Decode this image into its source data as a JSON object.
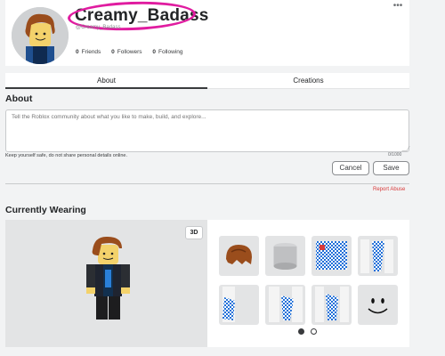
{
  "profile": {
    "username": "Creamy_Badass",
    "handle": "@Creamy_Badass",
    "stats": [
      {
        "count": "0",
        "label": "Friends"
      },
      {
        "count": "0",
        "label": "Followers"
      },
      {
        "count": "0",
        "label": "Following"
      }
    ],
    "more_label": "•••"
  },
  "tabs": [
    {
      "label": "About",
      "active": true
    },
    {
      "label": "Creations",
      "active": false
    }
  ],
  "about": {
    "title": "About",
    "placeholder": "Tell the Roblox community about what you like to make, build, and explore...",
    "char_count": "0/1000",
    "safety_note": "Keep yourself safe, do not share personal details online.",
    "cancel_label": "Cancel",
    "save_label": "Save",
    "report_label": "Report Abuse"
  },
  "wearing": {
    "title": "Currently Wearing",
    "view_mode_label": "3D",
    "items": [
      {
        "icon": "hair-icon"
      },
      {
        "icon": "head-icon"
      },
      {
        "icon": "checkered-shirt-icon"
      },
      {
        "icon": "checkered-scarf-icon"
      },
      {
        "icon": "scarf-left-icon"
      },
      {
        "icon": "scarf-right-icon"
      },
      {
        "icon": "scarf-side-icon"
      },
      {
        "icon": "smile-face-icon"
      }
    ],
    "page_dots": [
      {
        "active": true
      },
      {
        "active": false
      }
    ]
  },
  "colors": {
    "accent_highlight": "#e01ca0",
    "report_red": "#d83a3a",
    "checker_blue": "#1f6fd8"
  }
}
